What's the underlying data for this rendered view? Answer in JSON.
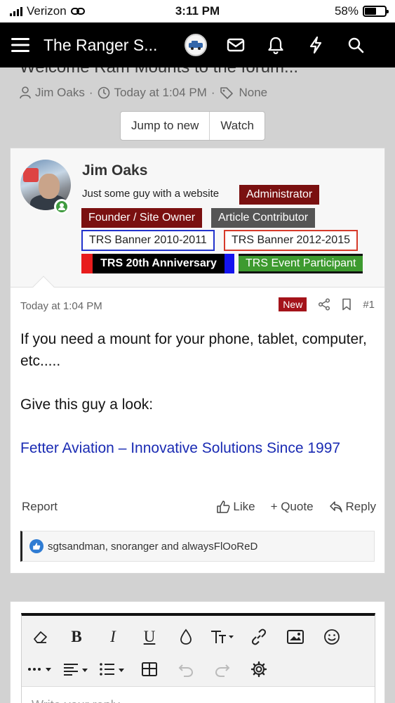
{
  "status_bar": {
    "carrier": "Verizon",
    "time": "3:11 PM",
    "battery": "58%",
    "battery_level": 0.58
  },
  "nav": {
    "title": "The Ranger S...",
    "icons": [
      "menu-icon",
      "site-logo",
      "mail-icon",
      "bell-icon",
      "lightning-icon",
      "search-icon"
    ]
  },
  "thread": {
    "title_partial": "Welcome Ram Mounts to the forum...",
    "author": "Jim Oaks",
    "date": "Today at 1:04 PM",
    "tags": "None",
    "separator": "·",
    "buttons": {
      "jump_to_new": "Jump to new",
      "watch": "Watch"
    }
  },
  "post": {
    "username": "Jim Oaks",
    "user_title": "Just some guy with a website",
    "badges": {
      "admin": "Administrator",
      "founder": "Founder / Site Owner",
      "article": "Article Contributor",
      "banner_2010": "TRS Banner 2010-2011",
      "banner_2012": "TRS Banner 2012-2015",
      "anniversary": "TRS 20th Anniversary",
      "event": "TRS Event Participant"
    },
    "date": "Today at 1:04 PM",
    "new_label": "New",
    "number": "#1",
    "body_line1": "If you need a mount for your phone, tablet, computer, etc.....",
    "body_line2": "Give this guy a look:",
    "link_text": "Fetter Aviation – Innovative Solutions Since 1997",
    "actions": {
      "report": "Report",
      "like": "Like",
      "quote": "+ Quote",
      "reply": "Reply"
    },
    "reactions": "sgtsandman, snoranger and alwaysFlOoReD"
  },
  "editor": {
    "placeholder": "Write your reply..."
  },
  "colors": {
    "admin_red": "#7a1010",
    "link_blue": "#1a2bb3",
    "new_badge": "#a4131a",
    "event_green": "#3d9a2f"
  }
}
